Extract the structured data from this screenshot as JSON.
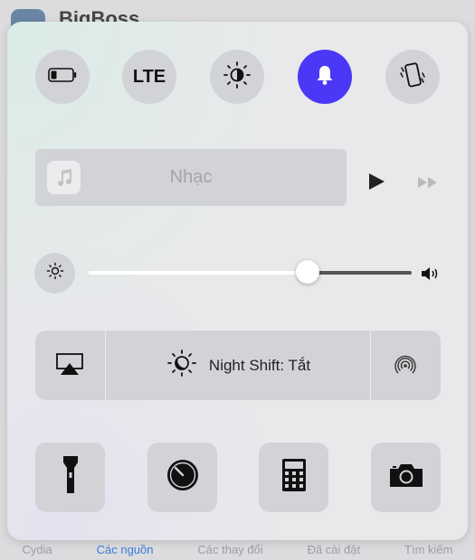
{
  "background_app": {
    "title": "BigBoss",
    "tabs": [
      {
        "label": "Cydia",
        "active": false
      },
      {
        "label": "Các nguồn",
        "active": true
      },
      {
        "label": "Các thay đổi",
        "active": false
      },
      {
        "label": "Đã cài đặt",
        "active": false
      },
      {
        "label": "Tìm kiếm",
        "active": false
      }
    ]
  },
  "toggles": [
    {
      "icon": "battery-icon",
      "label": "",
      "on": false
    },
    {
      "icon": "lte-icon",
      "label": "LTE",
      "on": false
    },
    {
      "icon": "brightness-auto-icon",
      "label": "",
      "on": false
    },
    {
      "icon": "bell-icon",
      "label": "",
      "on": true
    },
    {
      "icon": "phone-vibrate-icon",
      "label": "",
      "on": false
    }
  ],
  "music": {
    "title": "Nhạc",
    "icon": "music-note-icon"
  },
  "brightness": {
    "level": 0.68
  },
  "night_shift": {
    "label": "Night Shift: Tắt"
  },
  "shortcuts": [
    {
      "icon": "flashlight-icon"
    },
    {
      "icon": "timer-icon"
    },
    {
      "icon": "calculator-icon"
    },
    {
      "icon": "camera-icon"
    }
  ],
  "colors": {
    "accent": "#4b38f7",
    "tab_active": "#3a7bd8"
  }
}
